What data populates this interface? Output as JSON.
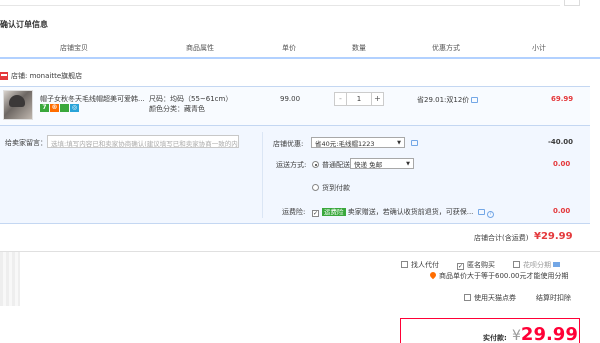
{
  "page": {
    "section_title": "确认订单信息"
  },
  "table_headers": [
    "店铺宝贝",
    "商品属性",
    "单价",
    "数量",
    "优惠方式",
    "小计"
  ],
  "shop": {
    "label": "店铺: monaitte旗舰店"
  },
  "item": {
    "name": "帽子女秋冬天毛线帽超美可爱韩...",
    "badges": [
      "7",
      "®",
      "",
      "◎"
    ],
    "attr_size": "尺码：均码（55~61cm）",
    "attr_color": "颜色分类：藏青色",
    "price": "99.00",
    "qty_minus": "-",
    "qty_value": "1",
    "qty_plus": "+",
    "promo": "省29.01:双12价",
    "subtotal": "69.99"
  },
  "message": {
    "label": "给卖家留言：",
    "placeholder": "选填:填写内容已和卖家协商确认(建议填写已和卖家协商一致的内容)"
  },
  "shop_promo": {
    "label": "店铺优惠:",
    "selected": "省40元:毛线帽1223",
    "amount": "-40.00"
  },
  "shipping": {
    "label": "运送方式:",
    "option1": "普通配送",
    "option1_select": "快递 免邮",
    "option2": "货到付款",
    "amount": "0.00"
  },
  "insurance": {
    "label": "运费险:",
    "tag": "运费险",
    "text": "卖家赠送，若确认收货前退货，可获保...",
    "amount": "0.00"
  },
  "shop_total": {
    "label": "店铺合计(含运费)",
    "amount": "¥29.99"
  },
  "options": {
    "proxy_pay": "找人代付",
    "anonymous": "匿名购买",
    "installment": "花呗分期",
    "notice": "商品单价大于等于600.00元才能使用分期",
    "tmall_points": "使用天猫点券",
    "points_deduct": "结算时扣除"
  },
  "payment": {
    "label": "实付款:",
    "currency": "¥",
    "amount": "29.99"
  },
  "colors": {
    "accent_red": "#ff0036",
    "price_red": "#e4393c",
    "header_line": "#b2d1ff",
    "tag_green": "#3aa83c"
  }
}
